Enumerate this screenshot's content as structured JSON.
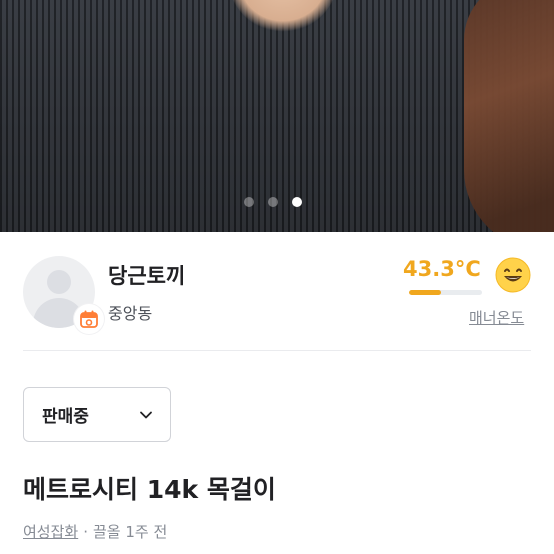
{
  "photo": {
    "alt": "",
    "pagination": {
      "count": 3,
      "active_index": 2
    }
  },
  "seller": {
    "name": "당근토끼",
    "location": "중앙동",
    "avatar_icon": "default-profile-icon",
    "badge_icon": "calendar-badge-icon",
    "manner_temperature": "43.3°C",
    "manner_temperature_value": 43.3,
    "manner_fill_fraction": 0.433,
    "manner_label": "매너온도",
    "temperature_emoji_icon": "grinning-face-icon",
    "accent_color": "#f0a71e"
  },
  "status": {
    "selected": "판매중",
    "chevron_icon": "chevron-down-icon"
  },
  "product": {
    "title": "메트로시티 14k 목걸이",
    "category": "여성잡화",
    "separator": "·",
    "bumped_time": "끌올 1주 전"
  }
}
